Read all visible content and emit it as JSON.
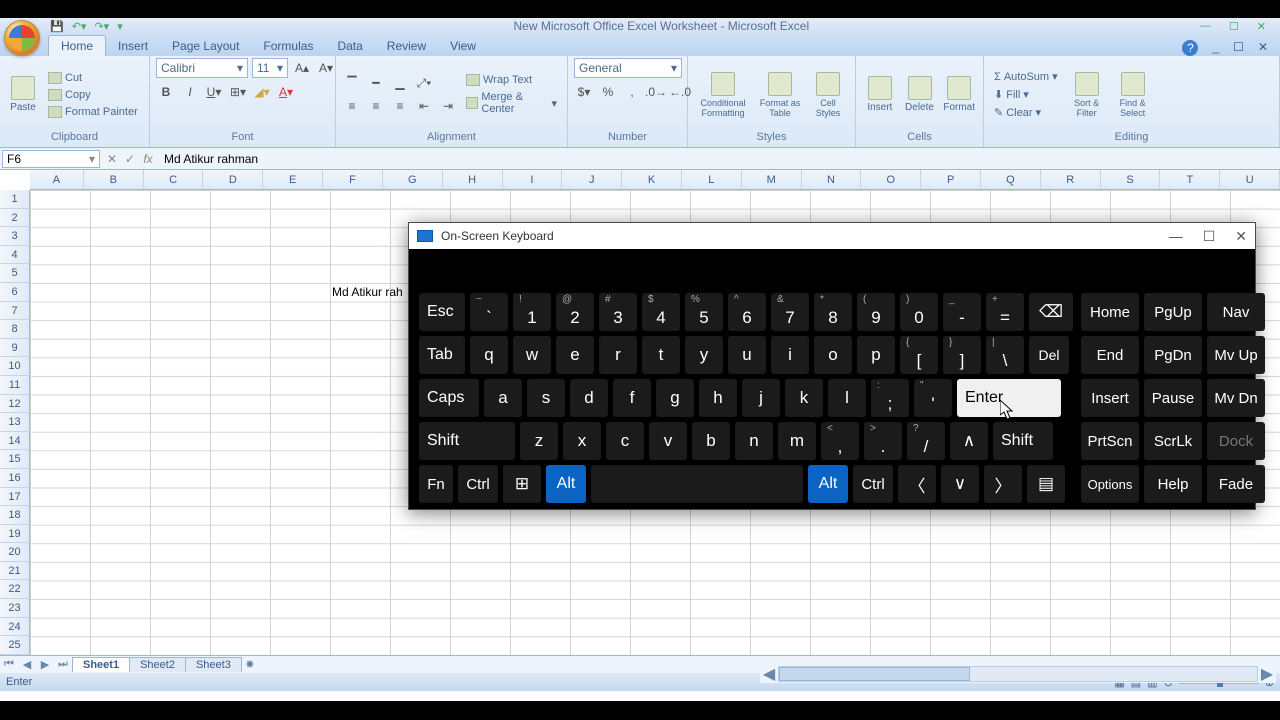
{
  "window": {
    "title": "New Microsoft Office Excel Worksheet - Microsoft Excel"
  },
  "tabs": [
    "Home",
    "Insert",
    "Page Layout",
    "Formulas",
    "Data",
    "Review",
    "View"
  ],
  "active_tab": "Home",
  "ribbon": {
    "clipboard": {
      "label": "Clipboard",
      "paste": "Paste",
      "cut": "Cut",
      "copy": "Copy",
      "fmtpainter": "Format Painter"
    },
    "font": {
      "label": "Font",
      "name": "Calibri",
      "size": "11"
    },
    "alignment": {
      "label": "Alignment",
      "wrap": "Wrap Text",
      "merge": "Merge & Center"
    },
    "number": {
      "label": "Number",
      "format": "General"
    },
    "styles": {
      "label": "Styles",
      "cond": "Conditional Formatting",
      "fmt": "Format as Table",
      "cell": "Cell Styles"
    },
    "cells": {
      "label": "Cells",
      "insert": "Insert",
      "delete": "Delete",
      "format": "Format"
    },
    "editing": {
      "label": "Editing",
      "sum": "AutoSum",
      "fill": "Fill",
      "clear": "Clear",
      "sort": "Sort & Filter",
      "find": "Find & Select"
    }
  },
  "namebox": "F6",
  "formula": "Md Atikur rahman",
  "columns": [
    "A",
    "B",
    "C",
    "D",
    "E",
    "F",
    "G",
    "H",
    "I",
    "J",
    "K",
    "L",
    "M",
    "N",
    "O",
    "P",
    "Q",
    "R",
    "S",
    "T",
    "U"
  ],
  "rows": [
    "1",
    "2",
    "3",
    "4",
    "5",
    "6",
    "7",
    "8",
    "9",
    "10",
    "11",
    "12",
    "13",
    "14",
    "15",
    "16",
    "17",
    "18",
    "19",
    "20",
    "21",
    "22",
    "23",
    "24",
    "25"
  ],
  "cell_f6": "Md Atikur rah",
  "sheets": [
    "Sheet1",
    "Sheet2",
    "Sheet3"
  ],
  "status": "Enter",
  "osk": {
    "title": "On-Screen Keyboard",
    "rows": {
      "r1": {
        "esc": "Esc",
        "k": [
          "1",
          "2",
          "3",
          "4",
          "5",
          "6",
          "7",
          "8",
          "9",
          "0",
          "-",
          "="
        ],
        "tops": [
          "`",
          "~",
          "!",
          "@",
          "#",
          "$",
          "%",
          "^",
          "&",
          "*",
          "(",
          ")",
          "_",
          "+"
        ]
      },
      "r2": {
        "tab": "Tab",
        "k": [
          "q",
          "w",
          "e",
          "r",
          "t",
          "y",
          "u",
          "i",
          "o",
          "p",
          "[",
          "]",
          "\\"
        ],
        "del": "Del"
      },
      "r3": {
        "caps": "Caps",
        "k": [
          "a",
          "s",
          "d",
          "f",
          "g",
          "h",
          "j",
          "k",
          "l",
          ";",
          "'"
        ],
        "enter": "Enter"
      },
      "r4": {
        "shiftL": "Shift",
        "k": [
          "z",
          "x",
          "c",
          "v",
          "b",
          "n",
          "m",
          ",",
          ".",
          "/"
        ],
        "up": "▲",
        "shiftR": "Shift"
      },
      "r5": {
        "fn": "Fn",
        "ctrlL": "Ctrl",
        "altL": "Alt",
        "altR": "Alt",
        "ctrlR": "Ctrl",
        "left": "〈",
        "down": "∨",
        "right": "〉"
      }
    },
    "nav": {
      "r1": [
        "Home",
        "PgUp",
        "Nav"
      ],
      "r2": [
        "End",
        "PgDn",
        "Mv Up"
      ],
      "r3": [
        "Insert",
        "Pause",
        "Mv Dn"
      ],
      "r4": [
        "PrtScn",
        "ScrLk",
        "Dock"
      ],
      "r5": [
        "Options",
        "Help",
        "Fade"
      ]
    }
  }
}
